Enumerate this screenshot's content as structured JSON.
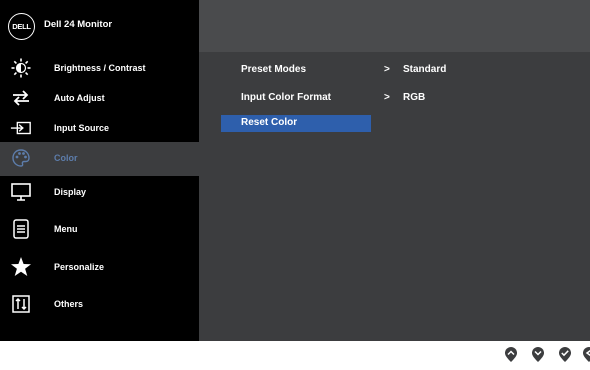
{
  "header": {
    "logo_text": "DELL",
    "title": "Dell 24 Monitor"
  },
  "sidebar": {
    "items": [
      {
        "label": "Brightness / Contrast",
        "icon": "brightness-icon"
      },
      {
        "label": "Auto Adjust",
        "icon": "auto-adjust-icon"
      },
      {
        "label": "Input Source",
        "icon": "input-source-icon"
      },
      {
        "label": "Color",
        "icon": "color-icon",
        "selected": true
      },
      {
        "label": "Display",
        "icon": "display-icon"
      },
      {
        "label": "Menu",
        "icon": "menu-icon"
      },
      {
        "label": "Personalize",
        "icon": "star-icon"
      },
      {
        "label": "Others",
        "icon": "others-icon"
      }
    ]
  },
  "main": {
    "rows": [
      {
        "label": "Preset Modes",
        "arrow": ">",
        "value": "Standard"
      },
      {
        "label": "Input Color Format",
        "arrow": ">",
        "value": "RGB"
      },
      {
        "label": "Reset Color",
        "arrow": "",
        "value": "",
        "highlighted": true
      }
    ]
  },
  "colors": {
    "sidebar_bg": "#000000",
    "panel_bg": "#3c3d3f",
    "header_bg": "#4a4b4d",
    "highlight": "#2e5fac",
    "selected_text": "#5d7dab"
  },
  "buttons": [
    {
      "icon": "up-arrow-button-icon"
    },
    {
      "icon": "down-arrow-button-icon"
    },
    {
      "icon": "confirm-check-button-icon"
    },
    {
      "icon": "back-button-icon"
    }
  ]
}
